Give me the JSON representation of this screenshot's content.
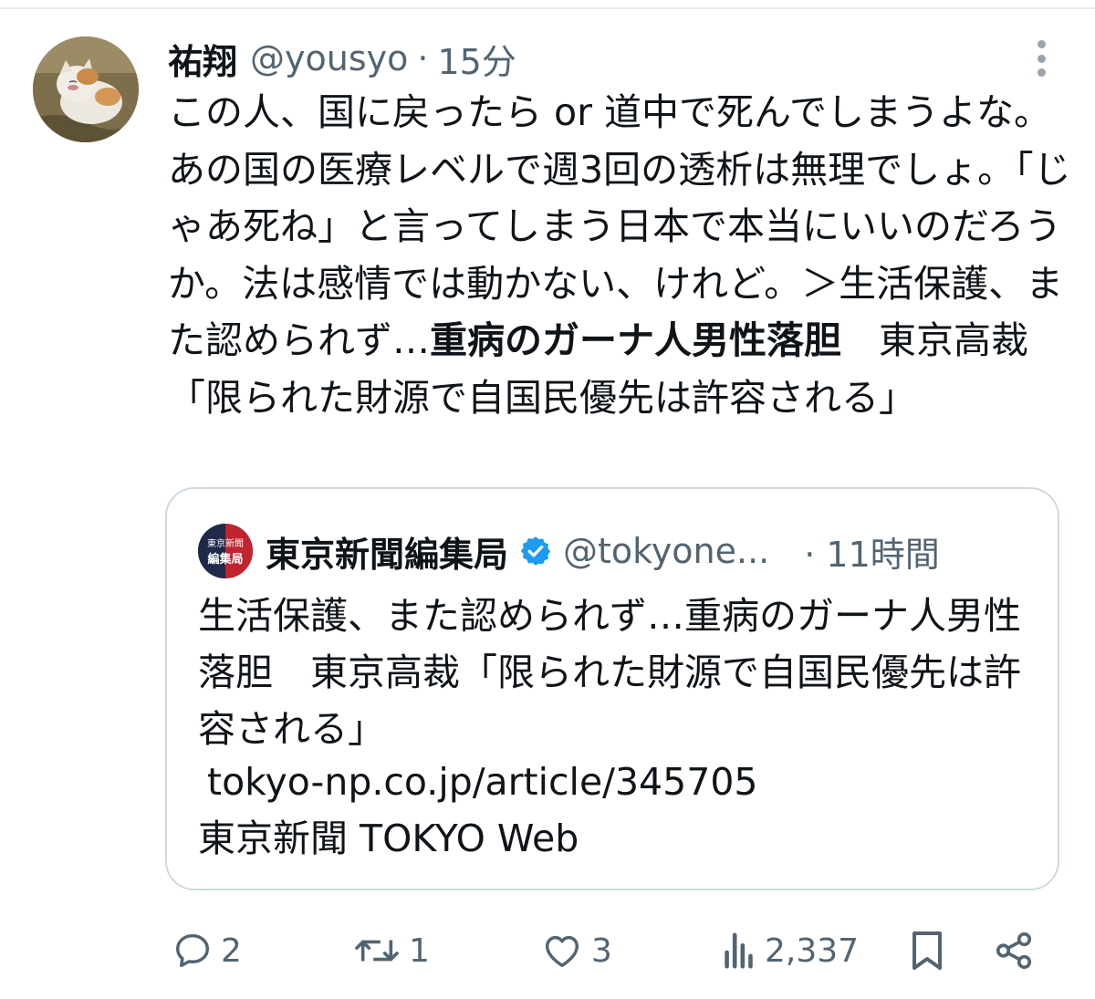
{
  "tweet": {
    "author_name": "祐翔",
    "author_handle": "@yousyo",
    "separator": "·",
    "time": "15分",
    "body": {
      "part1": "この人、国に戻ったら or 道中で死んでしまうよな。あの国の医療レベルで週3回の透析は無理でしょ。「じゃあ死ね」と言ってしまう日本で本当にいいのだろうか。法は感情では動かない、けれど。＞生活保護、また認められず…",
      "bold": "重病のガーナ人男性落胆",
      "part2": "　東京高裁「限られた財源で自国民優先は許容される」"
    }
  },
  "quote": {
    "author_name": "東京新聞編集局",
    "author_handle": "@tokyone...",
    "time": "· 11時間",
    "avatar_text_top": "東京新聞",
    "avatar_text_bottom": "編集局",
    "text": "生活保護、また認められず…重病のガーナ人男性落胆　東京高裁「限られた財源で自国民優先は許容される」",
    "link": "tokyo-np.co.jp/article/345705",
    "source": "東京新聞 TOKYO Web"
  },
  "actions": {
    "replies": "2",
    "retweets": "1",
    "likes": "3",
    "views": "2,337"
  },
  "colors": {
    "text": "#0f1419",
    "muted": "#536471",
    "border": "#cfd9de",
    "verified": "#1d9bf0"
  },
  "icons": [
    "more-icon",
    "reply-icon",
    "retweet-icon",
    "like-icon",
    "views-icon",
    "bookmark-icon",
    "share-icon",
    "verified-icon"
  ]
}
